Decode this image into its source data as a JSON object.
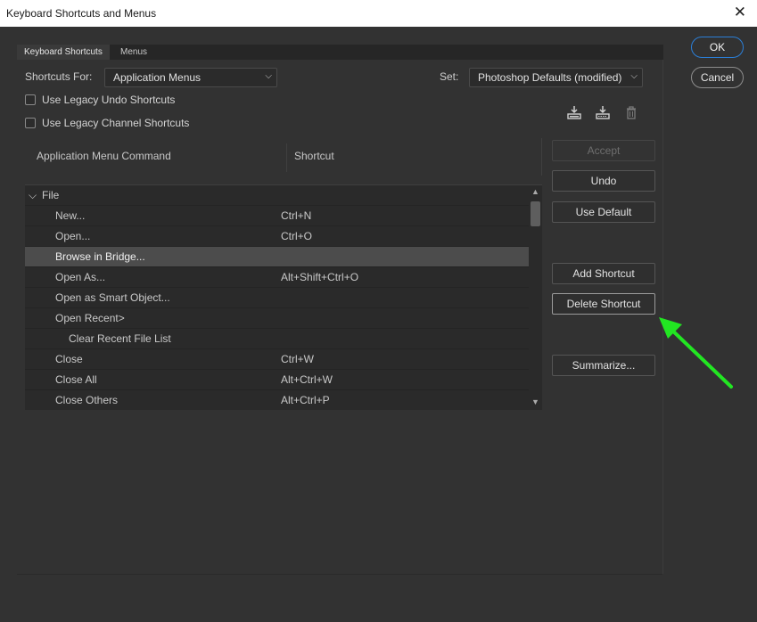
{
  "window": {
    "title": "Keyboard Shortcuts and Menus",
    "close_glyph": "✕"
  },
  "tabs": [
    {
      "label": "Keyboard Shortcuts",
      "active": true
    },
    {
      "label": "Menus",
      "active": false
    }
  ],
  "shortcuts_for": {
    "label": "Shortcuts For:",
    "value": "Application Menus"
  },
  "set": {
    "label": "Set:",
    "value": "Photoshop Defaults (modified)"
  },
  "checkboxes": {
    "legacy_undo": {
      "label": "Use Legacy Undo Shortcuts",
      "checked": false
    },
    "legacy_channel": {
      "label": "Use Legacy Channel Shortcuts",
      "checked": false
    }
  },
  "icons": [
    "save-set-icon",
    "save-set-as-icon",
    "delete-set-icon"
  ],
  "table": {
    "headers": {
      "command": "Application Menu Command",
      "shortcut": "Shortcut"
    },
    "rows": [
      {
        "command": "File",
        "shortcut": "",
        "level": 0,
        "expanded": true,
        "selected": false
      },
      {
        "command": "New...",
        "shortcut": "Ctrl+N",
        "level": 1,
        "selected": false
      },
      {
        "command": "Open...",
        "shortcut": "Ctrl+O",
        "level": 1,
        "selected": false
      },
      {
        "command": "Browse in Bridge...",
        "shortcut": "",
        "level": 1,
        "selected": true
      },
      {
        "command": "Open As...",
        "shortcut": "Alt+Shift+Ctrl+O",
        "level": 1,
        "selected": false
      },
      {
        "command": "Open as Smart Object...",
        "shortcut": "",
        "level": 1,
        "selected": false
      },
      {
        "command": "Open Recent>",
        "shortcut": "",
        "level": 1,
        "selected": false
      },
      {
        "command": "Clear Recent File List",
        "shortcut": "",
        "level": 2,
        "selected": false
      },
      {
        "command": "Close",
        "shortcut": "Ctrl+W",
        "level": 1,
        "selected": false
      },
      {
        "command": "Close All",
        "shortcut": "Alt+Ctrl+W",
        "level": 1,
        "selected": false
      },
      {
        "command": "Close Others",
        "shortcut": "Alt+Ctrl+P",
        "level": 1,
        "selected": false
      }
    ]
  },
  "buttons": {
    "accept": "Accept",
    "undo": "Undo",
    "use_default": "Use Default",
    "add_shortcut": "Add Shortcut",
    "delete_shortcut": "Delete Shortcut",
    "summarize": "Summarize...",
    "ok": "OK",
    "cancel": "Cancel"
  },
  "colors": {
    "accent": "#2b7fd8",
    "annotation_arrow": "#22e622"
  }
}
